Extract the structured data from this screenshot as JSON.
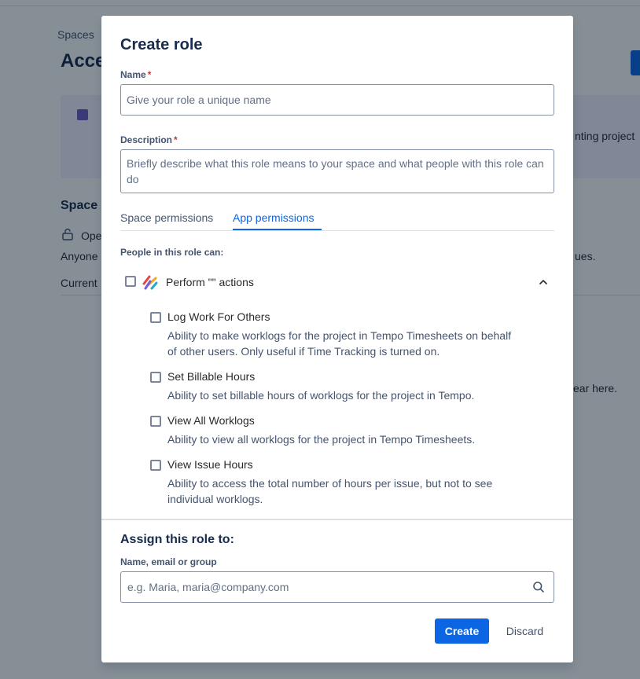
{
  "background": {
    "breadcrumb": "Spaces",
    "page_title": "Acce",
    "banner_text": "nting project",
    "section_heading": "Space",
    "access_option": "Ope",
    "access_desc": "Anyone",
    "access_desc_tail": "ues.",
    "current_label": "Current",
    "empty_state_tail": "ear here."
  },
  "modal": {
    "title": "Create role",
    "name_field": {
      "label": "Name",
      "required_mark": "*",
      "placeholder": "Give your role a unique name"
    },
    "description_field": {
      "label": "Description",
      "required_mark": "*",
      "placeholder": "Briefly describe what this role means to your space and what people with this role can do"
    },
    "tabs": [
      {
        "label": "Space permissions",
        "selected": false
      },
      {
        "label": "App permissions",
        "selected": true
      }
    ],
    "permissions_heading": "People in this role can:",
    "app_group": {
      "label": "Perform \"\" actions",
      "icon": "tempo-app-logo",
      "expanded": true,
      "permissions": [
        {
          "title": "Log Work For Others",
          "description": "Ability to make worklogs for the project in Tempo Timesheets on behalf of other users. Only useful if Time Tracking is turned on.",
          "checked": false
        },
        {
          "title": "Set Billable Hours",
          "description": "Ability to set billable hours of worklogs for the project in Tempo.",
          "checked": false
        },
        {
          "title": "View All Worklogs",
          "description": "Ability to view all worklogs for the project in Tempo Timesheets.",
          "checked": false
        },
        {
          "title": "View Issue Hours",
          "description": "Ability to access the total number of hours per issue, but not to see individual worklogs.",
          "checked": false
        }
      ]
    },
    "assign": {
      "title": "Assign this role to:",
      "field_label": "Name, email or group",
      "placeholder": "e.g. Maria, maria@company.com"
    },
    "actions": {
      "create": "Create",
      "discard": "Discard"
    }
  },
  "colors": {
    "primary": "#0c66e4",
    "required": "#c9372c",
    "overlay": "rgba(5,21,36,0.48)"
  }
}
